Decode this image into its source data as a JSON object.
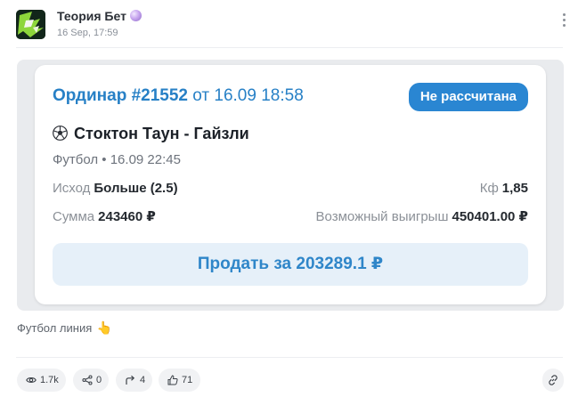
{
  "header": {
    "channel_name": "Теория Бет",
    "post_time": "16 Sep, 17:59"
  },
  "bet_card": {
    "ordinar_label": "Ординар #21552",
    "date_text": "от 16.09 18:58",
    "status": "Не рассчитана",
    "match": "Стоктон Таун - Гайзли",
    "sport_line": "Футбол • 16.09 22:45",
    "outcome_label": "Исход",
    "outcome_value": "Больше (2.5)",
    "coef_label": "Кф",
    "coef_value": "1,85",
    "sum_label": "Сумма",
    "sum_value": "243460 ₽",
    "win_label": "Возможный выигрыш",
    "win_value": "450401.00 ₽",
    "sell_button": "Продать за 203289.1 ₽"
  },
  "caption": {
    "text": "Футбол линия",
    "emoji": "👆"
  },
  "stats": {
    "views": "1.7k",
    "shares": "0",
    "forwards": "4",
    "likes": "71"
  },
  "icons": {
    "more": "more-vertical-icon",
    "ball": "soccer-ball-icon",
    "views": "eye-icon",
    "shares": "share-icon",
    "forwards": "forward-arrow-icon",
    "likes": "thumbs-up-icon",
    "link": "link-icon"
  },
  "colors": {
    "accent": "#2780c6",
    "badge": "#2a86d2",
    "sell_bg": "#e6f0f9"
  }
}
